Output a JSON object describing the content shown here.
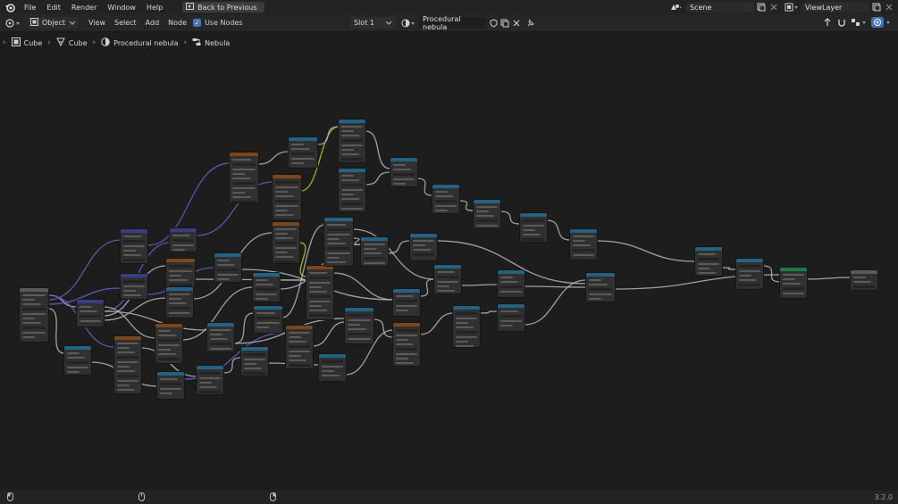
{
  "menubar": {
    "items": [
      "File",
      "Edit",
      "Render",
      "Window",
      "Help"
    ],
    "back_label": "Back to Previous",
    "scene": "Scene",
    "view_layer": "ViewLayer"
  },
  "header": {
    "mode": "Object",
    "menus": [
      "View",
      "Select",
      "Add",
      "Node"
    ],
    "use_nodes_label": "Use Nodes",
    "use_nodes_checked": true,
    "slot": "Slot 1",
    "material_name": "Procedural nebula"
  },
  "breadcrumb": {
    "items": [
      {
        "label": "Cube",
        "icon": "object-icon"
      },
      {
        "label": "Cube",
        "icon": "mesh-icon"
      },
      {
        "label": "Procedural nebula",
        "icon": "material-icon"
      },
      {
        "label": "Nebula",
        "icon": "node-tree-icon"
      }
    ]
  },
  "status": {
    "version": "3.2.0"
  },
  "colors": {
    "header_vector": "#3c3c83",
    "header_converter": "#246283",
    "header_input": "#83314a",
    "header_texture": "#79461d",
    "header_shader": "#1f7745",
    "wire": "#b8b8b8",
    "wire_blue": "#6363c7",
    "wire_yellow": "#c7c729"
  }
}
